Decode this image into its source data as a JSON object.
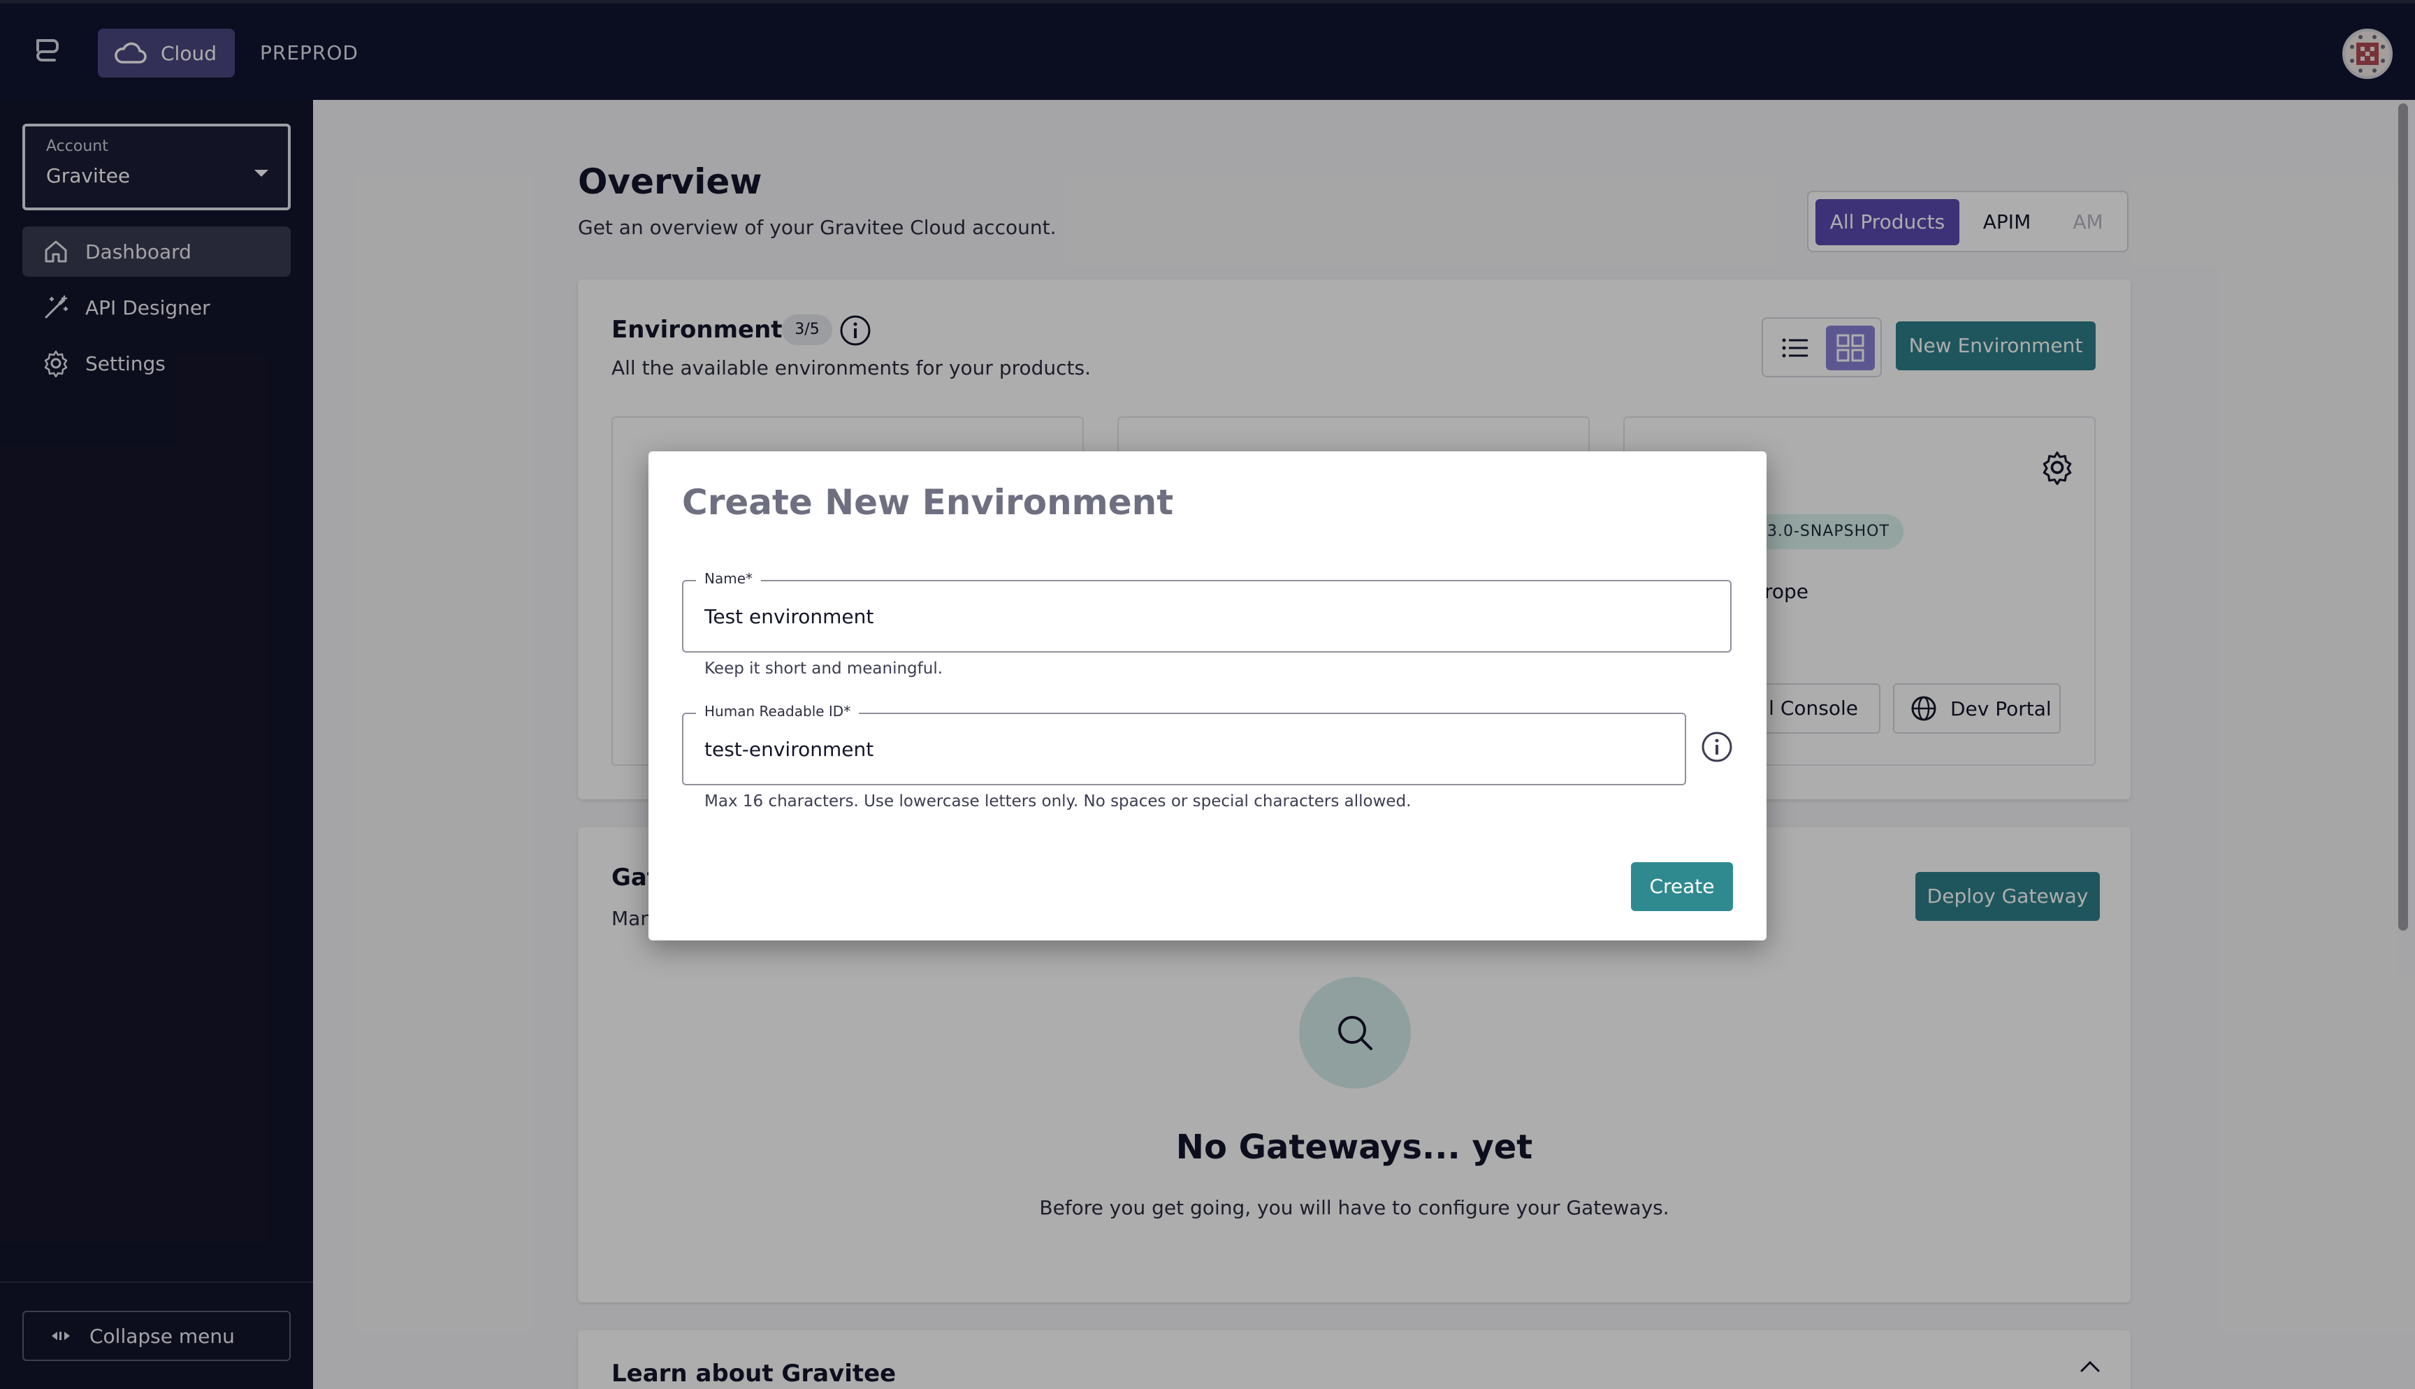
{
  "topbar": {
    "cloud_label": "Cloud",
    "env_label": "PREPROD"
  },
  "sidebar": {
    "account_label": "Account",
    "account_value": "Gravitee",
    "items": [
      {
        "label": "Dashboard",
        "icon": "home-icon",
        "active": true
      },
      {
        "label": "API Designer",
        "icon": "wand-icon",
        "active": false
      },
      {
        "label": "Settings",
        "icon": "gear-icon",
        "active": false
      }
    ],
    "collapse_label": "Collapse menu"
  },
  "main": {
    "title": "Overview",
    "subtitle": "Get an overview of your Gravitee Cloud account.",
    "product_filter": {
      "options": [
        "All Products",
        "APIM",
        "AM"
      ],
      "selected": "All Products"
    },
    "environments": {
      "title": "Environments",
      "count_badge": "3/5",
      "subtitle": "All the available environments for your products.",
      "new_button": "New Environment",
      "view_selected": "grid",
      "visible_item": {
        "version_badge": "3.0-SNAPSHOT",
        "region_text": "rope",
        "console_button": "l Console",
        "devportal_button": "Dev Portal"
      }
    },
    "gateways": {
      "title": "Gat",
      "subtitle": "Man",
      "deploy_button": "Deploy Gateway",
      "empty_title": "No Gateways... yet",
      "empty_subtitle": "Before you get going, you will have to configure your Gateways."
    },
    "learn": {
      "title": "Learn about Gravitee"
    }
  },
  "modal": {
    "title": "Create New Environment",
    "name_field": {
      "label": "Name*",
      "value": "Test environment",
      "hint": "Keep it short and meaningful."
    },
    "hrid_field": {
      "label": "Human Readable ID*",
      "value": "test-environment",
      "hint": "Max 16 characters. Use lowercase letters only. No spaces or special characters allowed."
    },
    "create_button": "Create"
  },
  "colors": {
    "topbar_bg": "#111430",
    "sidebar_bg": "#14152b",
    "primary_purple": "#5a4bb2",
    "primary_teal": "#2f7f8a"
  }
}
